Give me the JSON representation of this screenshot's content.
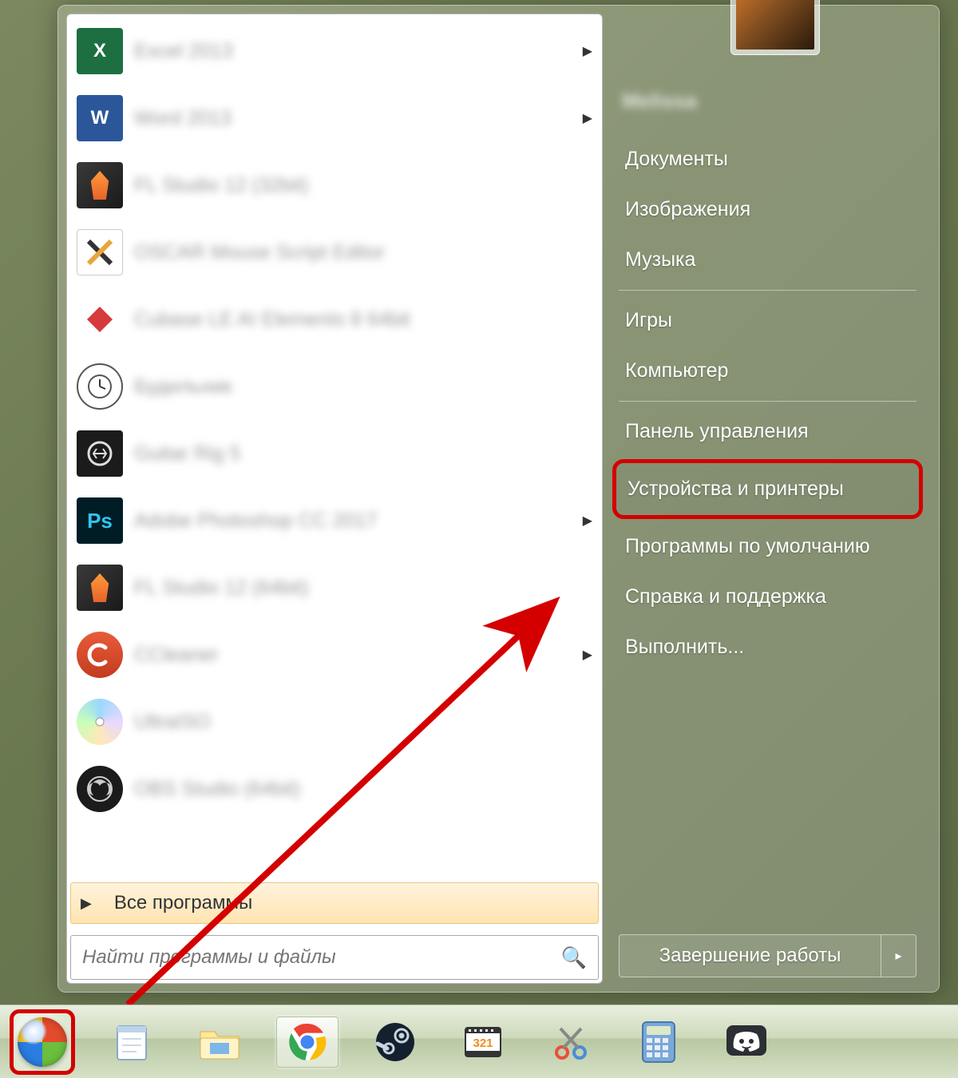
{
  "programs": [
    {
      "label": "Excel 2013",
      "icon": "excel-icon",
      "hasSubmenu": true
    },
    {
      "label": "Word 2013",
      "icon": "word-icon",
      "hasSubmenu": true
    },
    {
      "label": "FL Studio 12 (32bit)",
      "icon": "flstudio-icon",
      "hasSubmenu": false
    },
    {
      "label": "OSCAR Mouse Script Editor",
      "icon": "oscar-icon",
      "hasSubmenu": false
    },
    {
      "label": "Cubase LE AI Elements 8 64bit",
      "icon": "cubase-icon",
      "hasSubmenu": false
    },
    {
      "label": "Будильник",
      "icon": "clock-icon",
      "hasSubmenu": false
    },
    {
      "label": "Guitar Rig 5",
      "icon": "guitarrig-icon",
      "hasSubmenu": false
    },
    {
      "label": "Adobe Photoshop CC 2017",
      "icon": "photoshop-icon",
      "hasSubmenu": true
    },
    {
      "label": "FL Studio 12 (64bit)",
      "icon": "flstudio-icon",
      "hasSubmenu": false
    },
    {
      "label": "CCleaner",
      "icon": "ccleaner-icon",
      "hasSubmenu": true
    },
    {
      "label": "UltraISO",
      "icon": "ultraiso-icon",
      "hasSubmenu": false
    },
    {
      "label": "OBS Studio (64bit)",
      "icon": "obs-icon",
      "hasSubmenu": false
    }
  ],
  "allPrograms": "Все программы",
  "searchPlaceholder": "Найти программы и файлы",
  "userName": "Melissa",
  "rightPanel": {
    "topLinks": [
      "Документы",
      "Изображения",
      "Музыка"
    ],
    "midLinks": [
      "Игры",
      "Компьютер"
    ],
    "bottomLinks": [
      "Панель управления",
      "Устройства и принтеры",
      "Программы по умолчанию",
      "Справка и поддержка",
      "Выполнить..."
    ],
    "highlightedIndex": 1
  },
  "shutdown": {
    "label": "Завершение работы"
  },
  "taskbar": [
    {
      "name": "start-button",
      "title": "Пуск"
    },
    {
      "name": "notepad-icon",
      "title": "Notepad"
    },
    {
      "name": "explorer-icon",
      "title": "Проводник"
    },
    {
      "name": "chrome-icon",
      "title": "Google Chrome"
    },
    {
      "name": "steam-icon",
      "title": "Steam"
    },
    {
      "name": "mpc-icon",
      "title": "Media Player Classic"
    },
    {
      "name": "snipping-icon",
      "title": "Ножницы"
    },
    {
      "name": "calculator-icon",
      "title": "Калькулятор"
    },
    {
      "name": "discord-icon",
      "title": "Discord"
    }
  ]
}
